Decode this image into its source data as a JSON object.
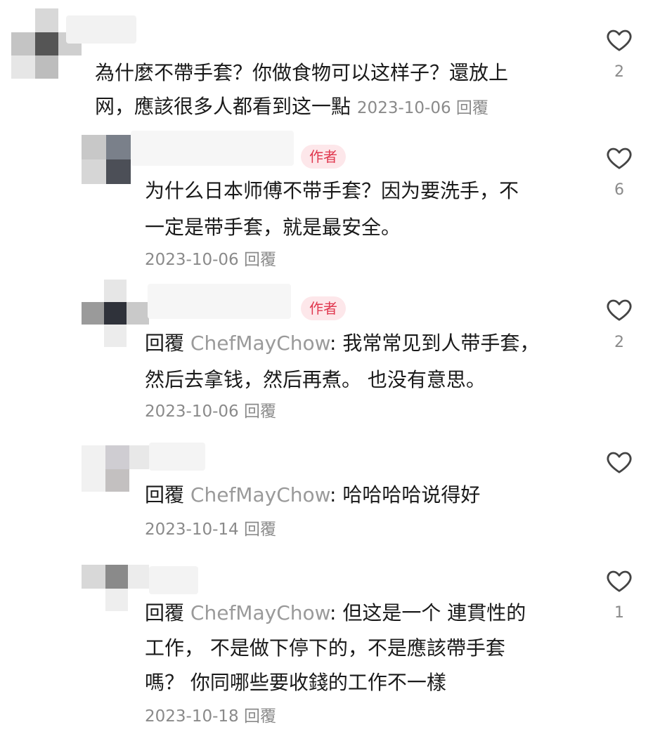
{
  "comments": [
    {
      "lines": [
        "為什麼不帶手套？你做食物可以这样子？還放上",
        "网，應該很多人都看到这一點"
      ],
      "date": "2023-10-06",
      "reply": "回覆",
      "likes": "2"
    },
    {
      "badge": "作者",
      "lines": [
        "为什么日本师傅不带手套？因为要洗手，不",
        "一定是带手套，就是最安全。"
      ],
      "date": "2023-10-06",
      "reply": "回覆",
      "likes": "6"
    },
    {
      "badge": "作者",
      "reply_prefix": "回覆",
      "mention": "ChefMayChow",
      "lines": [
        ": 我常常见到人带手套，",
        "然后去拿钱，然后再煮。  也没有意思。"
      ],
      "date": "2023-10-06",
      "reply": "回覆",
      "likes": "2"
    },
    {
      "reply_prefix": "回覆",
      "mention": "ChefMayChow",
      "lines": [
        ": 哈哈哈哈说得好"
      ],
      "date": "2023-10-14",
      "reply": "回覆",
      "likes": ""
    },
    {
      "reply_prefix": "回覆",
      "mention": "ChefMayChow",
      "lines": [
        ": 但这是一个 連貫性的",
        "工作，  不是做下停下的，不是應該帶手套",
        "嗎？  你同哪些要收錢的工作不一樣"
      ],
      "date": "2023-10-18",
      "reply": "回覆",
      "likes": "1"
    }
  ],
  "icons": {
    "like": "heart-outline-icon"
  },
  "colors": {
    "author_badge_bg": "#fde7ea",
    "author_badge_text": "#e0384f",
    "meta": "#8a8a8a"
  }
}
